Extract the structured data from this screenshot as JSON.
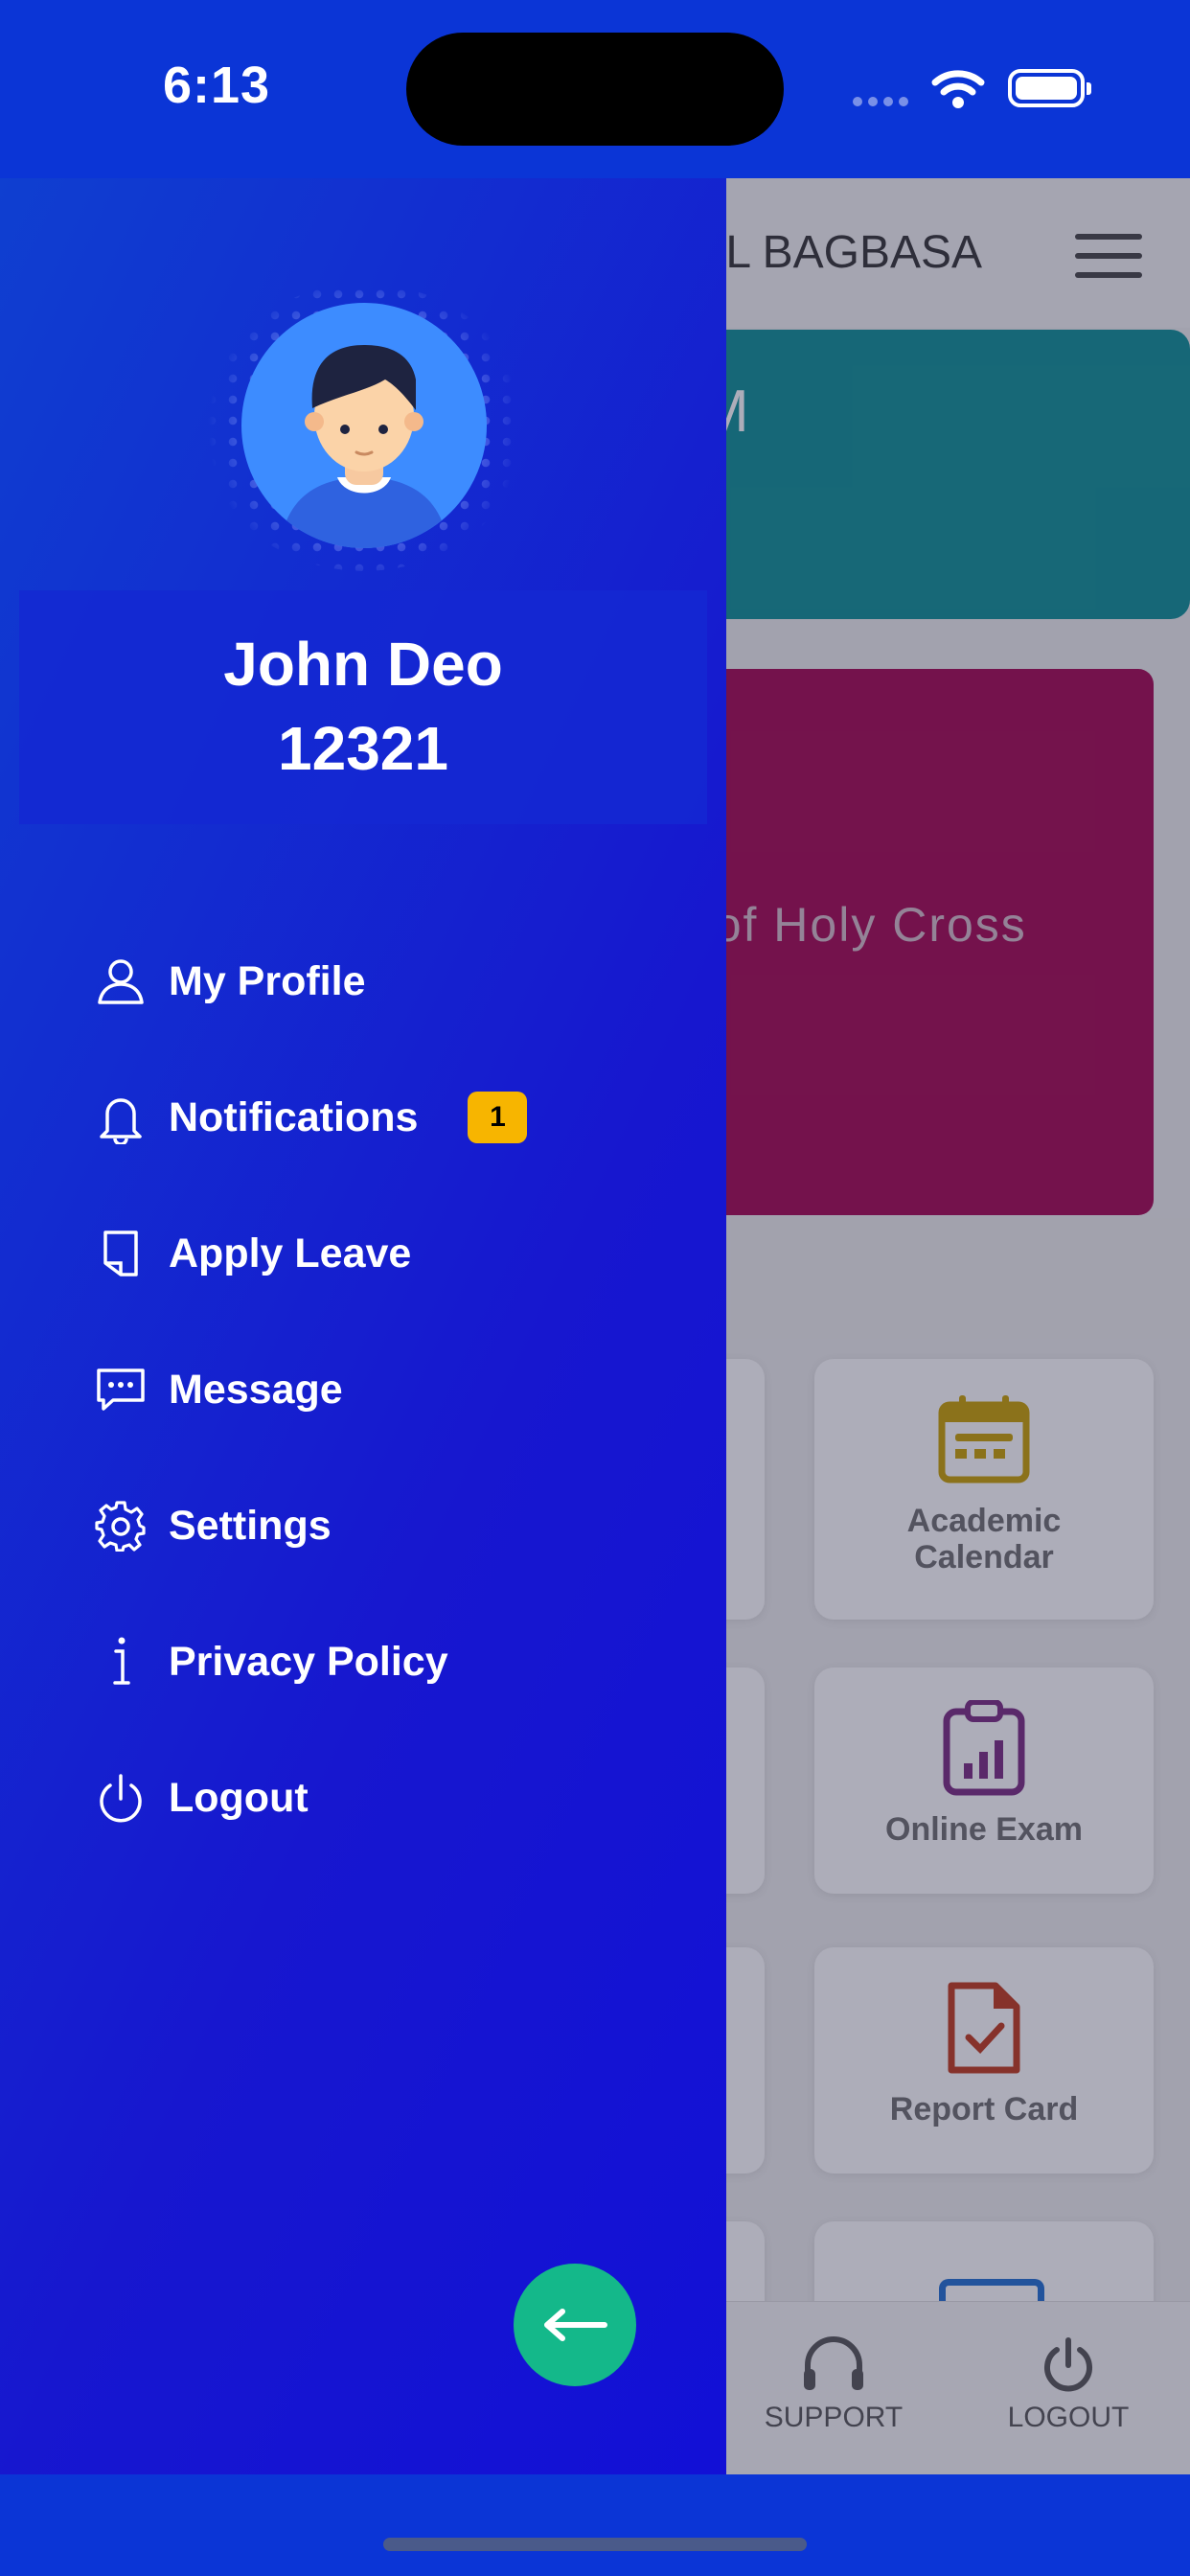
{
  "status_bar": {
    "time": "6:13"
  },
  "background_app": {
    "header_title": "OL BAGBASA",
    "teal_card_text": "M",
    "maroon_card_text": "o of Holy Cross",
    "tiles": [
      {
        "label": "Academic Calendar",
        "icon": "calendar-icon",
        "color": "#c9a100"
      },
      {
        "label": "Online Exam",
        "icon": "clipboard-chart-icon",
        "color": "#7a2a80"
      },
      {
        "label": "Report Card",
        "icon": "document-check-icon",
        "color": "#c0391b"
      }
    ],
    "bottom_nav": [
      {
        "label": "SUPPORT",
        "icon": "headset-icon"
      },
      {
        "label": "LOGOUT",
        "icon": "power-icon"
      }
    ]
  },
  "drawer": {
    "user_name": "John Deo",
    "user_id": "12321",
    "menu": [
      {
        "label": "My Profile",
        "icon": "user-icon"
      },
      {
        "label": "Notifications",
        "icon": "bell-icon",
        "badge": "1"
      },
      {
        "label": "Apply Leave",
        "icon": "document-icon"
      },
      {
        "label": "Message",
        "icon": "message-icon"
      },
      {
        "label": "Settings",
        "icon": "gear-icon"
      },
      {
        "label": "Privacy Policy",
        "icon": "info-icon"
      },
      {
        "label": "Logout",
        "icon": "power-icon"
      }
    ],
    "accent_color": "#14b88a"
  }
}
